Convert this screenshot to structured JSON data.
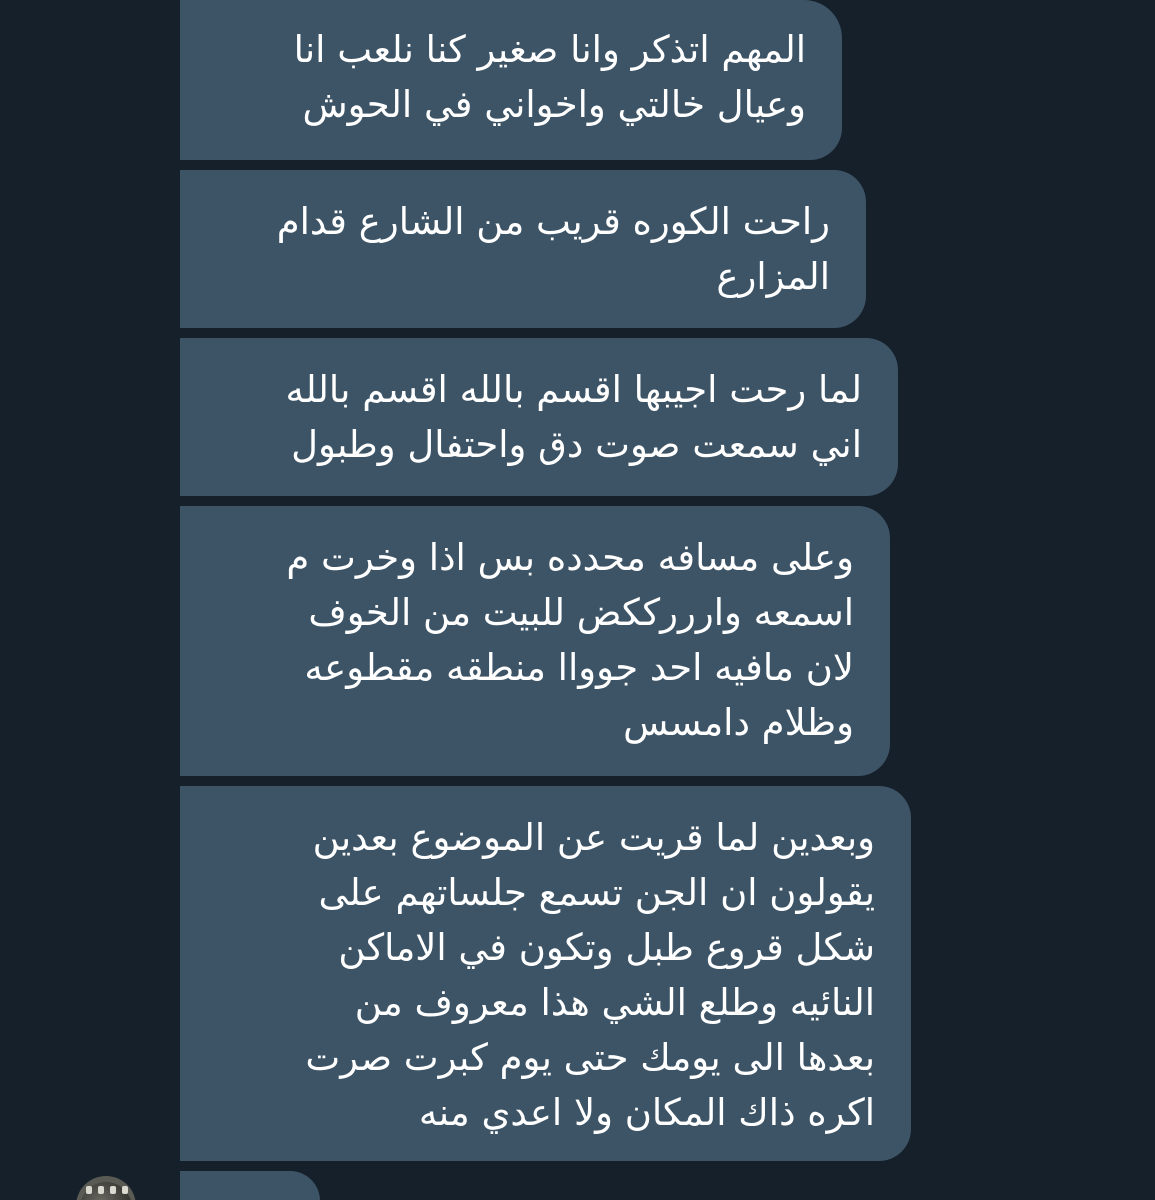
{
  "messages": [
    {
      "lines": [
        "المهم اتذكر وانا صغير كنا نلعب انا",
        "وعيال خالتي واخواني في الحوش"
      ]
    },
    {
      "lines": [
        "راحت الكوره قريب من الشارع قدام",
        "المزارع"
      ]
    },
    {
      "lines": [
        "لما رحت اجيبها اقسم بالله اقسم بالله",
        "اني سمعت صوت دق واحتفال وطبول"
      ]
    },
    {
      "lines": [
        "وعلى مسافه محدده بس اذا وخرت م",
        "اسمعه وارررككض للبيت من الخوف",
        "لان مافيه احد جوواا منطقه مقطوعه",
        "وظلام دامسس"
      ]
    },
    {
      "lines": [
        "وبعدين لما قريت عن الموضوع بعدين",
        "يقولون ان الجن تسمع جلساتهم على",
        "شكل قروع طبل وتكون في الاماكن",
        "النائيه وطلع الشي هذا معروف من",
        "بعدها الى يومك حتى يوم كبرت صرت",
        "اكره ذاك المكان ولا اعدي منه"
      ]
    }
  ],
  "colors": {
    "background": "#15202b",
    "bubble": "#3d5466",
    "text": "#ffffff"
  },
  "icons": {
    "avatar": "user-avatar"
  }
}
